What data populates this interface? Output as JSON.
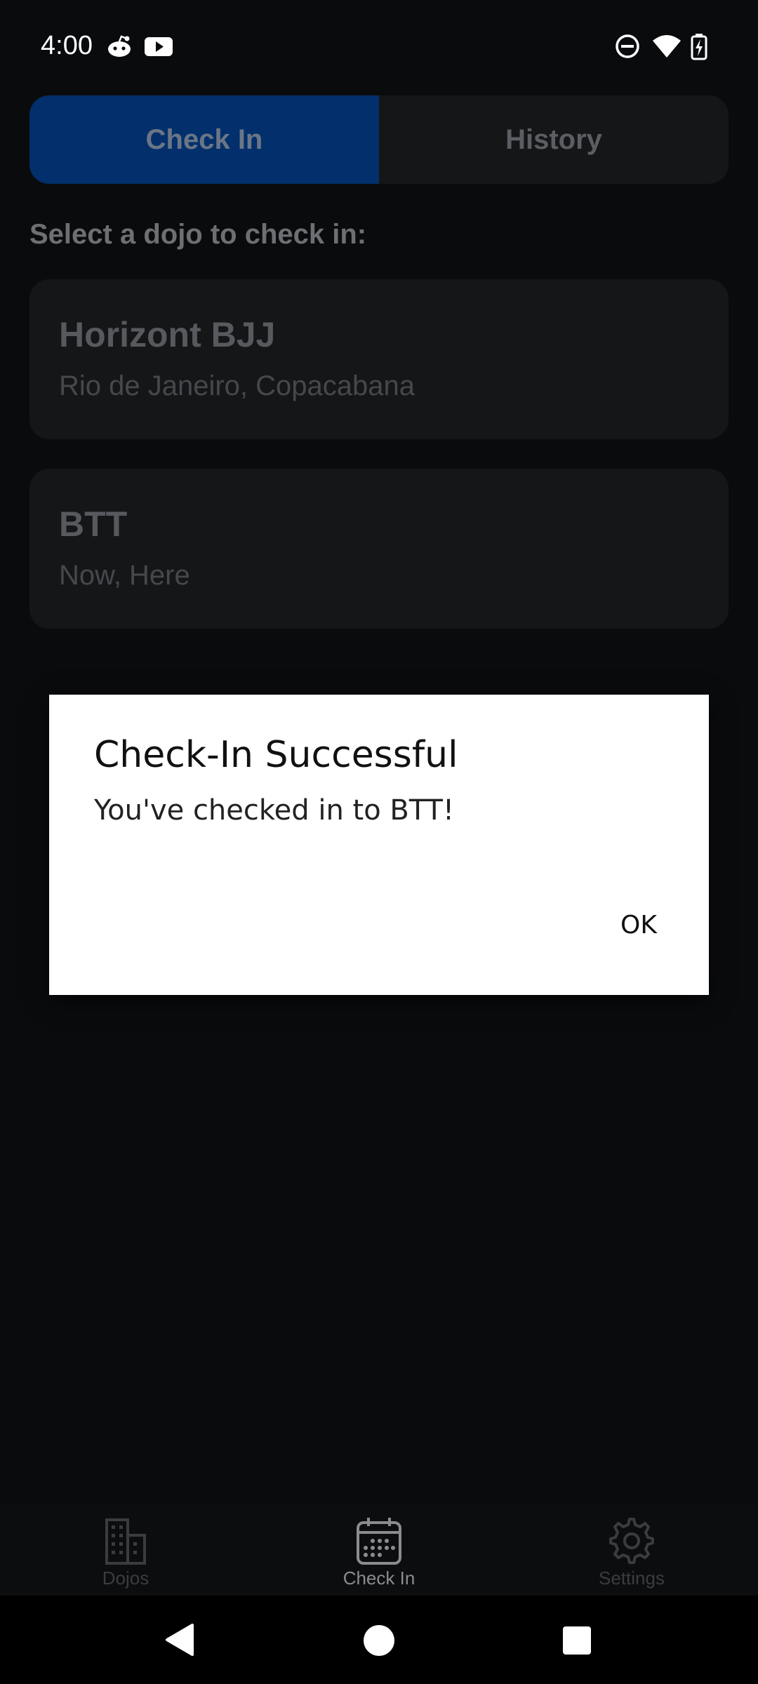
{
  "status_bar": {
    "time": "4:00",
    "left_icons": [
      "reddit-icon",
      "youtube-icon"
    ],
    "right_icons": [
      "do-not-disturb-icon",
      "wifi-icon",
      "battery-charging-icon"
    ]
  },
  "tabs": [
    {
      "label": "Check In",
      "active": true
    },
    {
      "label": "History",
      "active": false
    }
  ],
  "prompt": "Select a dojo to check in:",
  "dojos": [
    {
      "name": "Horizont BJJ",
      "location": "Rio de Janeiro, Copacabana"
    },
    {
      "name": "BTT",
      "location": "Now, Here"
    }
  ],
  "dialog": {
    "title": "Check-In Successful",
    "message": "You've checked in to BTT!",
    "ok_label": "OK"
  },
  "bottom_nav": [
    {
      "label": "Dojos",
      "icon": "building-icon",
      "active": false
    },
    {
      "label": "Check In",
      "icon": "calendar-icon",
      "active": true
    },
    {
      "label": "Settings",
      "icon": "gear-icon",
      "active": false
    }
  ],
  "system_nav": [
    "back-icon",
    "home-icon",
    "recents-icon"
  ],
  "colors": {
    "background": "#0a0b0d",
    "active_tab": "#03306c",
    "card": "#151617",
    "dialog": "#ffffff"
  }
}
